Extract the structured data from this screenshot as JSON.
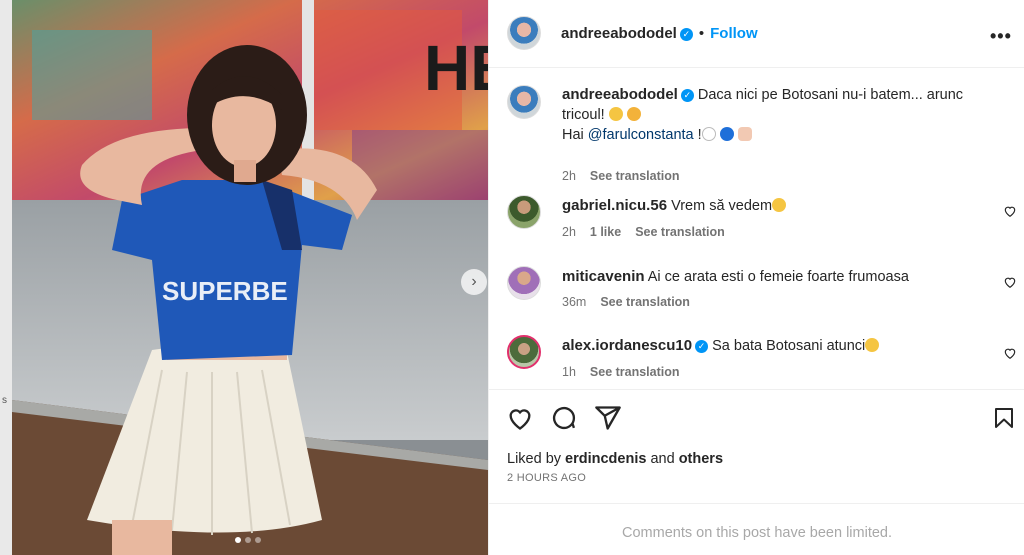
{
  "post": {
    "author": "andreeabododel",
    "follow_label": "Follow",
    "separator": "•",
    "more_label": "•••",
    "caption_line1": "Daca nici pe Botosani nu-i batem... arunc tricoul!",
    "caption_line2_prefix": "Hai",
    "caption_mention": "@farulconstanta",
    "caption_line2_suffix": "!",
    "caption_time": "2h",
    "see_translation": "See translation",
    "carousel_next": "›",
    "liked_by_prefix": "Liked by",
    "liked_by_user": "erdincdenis",
    "liked_by_and": "and",
    "liked_by_others": "others",
    "time_ago": "2 HOURS AGO",
    "comments_limited": "Comments on this post have been limited."
  },
  "comments": [
    {
      "username": "gabriel.nicu.56",
      "text": "Vrem să vedem",
      "time": "2h",
      "likes": "1 like",
      "translation": "See translation"
    },
    {
      "username": "miticavenin",
      "text": "Ai ce arata esti o femeie foarte frumoasa",
      "time": "36m",
      "translation": "See translation"
    },
    {
      "username": "alex.iordanescu10",
      "text": "Sa bata Botosani atunci",
      "time": "1h",
      "translation": "See translation"
    }
  ],
  "colors": {
    "accent": "#0095f6",
    "mention": "#00376b",
    "muted": "#737373"
  },
  "icons": [
    "heart-icon",
    "comment-icon",
    "share-icon",
    "bookmark-icon",
    "verified-icon",
    "more-icon",
    "chevron-right-icon"
  ]
}
